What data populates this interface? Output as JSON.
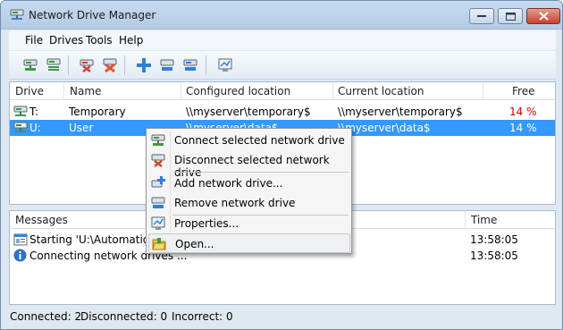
{
  "window": {
    "title": "Network Drive Manager"
  },
  "menu": [
    "File",
    "Drives",
    "Tools",
    "Help"
  ],
  "toolbar": {
    "icons": [
      "connect-icon",
      "connect-all-icon",
      "disconnect-icon",
      "disconnect-all-icon",
      "add-drive-icon",
      "remove-drive-icon",
      "edit-drive-icon",
      "properties-icon"
    ]
  },
  "drives": {
    "headers": {
      "drive": "Drive",
      "name": "Name",
      "configured": "Configured location",
      "current": "Current location",
      "free": "Free"
    },
    "rows": [
      {
        "drive": "T:",
        "name": "Temporary",
        "configured": "\\\\myserver\\temporary$",
        "current": "\\\\myserver\\temporary$",
        "free": "14 %"
      },
      {
        "drive": "U:",
        "name": "User",
        "configured": "\\\\myserver\\data$",
        "current": "\\\\myserver\\data$",
        "free": "14 %"
      }
    ]
  },
  "messages": {
    "headers": {
      "messages": "Messages",
      "time": "Time"
    },
    "rows": [
      {
        "text": "Starting 'U:\\Automation'",
        "time": "13:58:05",
        "icon": "log-icon"
      },
      {
        "text": "Connecting network drives ...",
        "time": "13:58:05",
        "icon": "info-icon"
      }
    ]
  },
  "context_menu": {
    "items": [
      {
        "label": "Connect selected network drive",
        "icon": "connect-icon"
      },
      {
        "label": "Disconnect selected network drive",
        "icon": "disconnect-icon"
      },
      {
        "label": "Add network drive...",
        "icon": "add-drive-icon"
      },
      {
        "label": "Remove network drive",
        "icon": "remove-drive-icon"
      },
      {
        "label": "Properties...",
        "icon": "properties-icon"
      },
      {
        "label": "Open...",
        "icon": "open-folder-icon"
      }
    ]
  },
  "status": {
    "connected": "Connected: 2",
    "disconnected": "Disconnected: 0",
    "incorrect": "Incorrect: 0"
  },
  "colors": {
    "selection": "#3399ff",
    "free_text": "#c00000",
    "title_bg": "#c7daf0"
  }
}
